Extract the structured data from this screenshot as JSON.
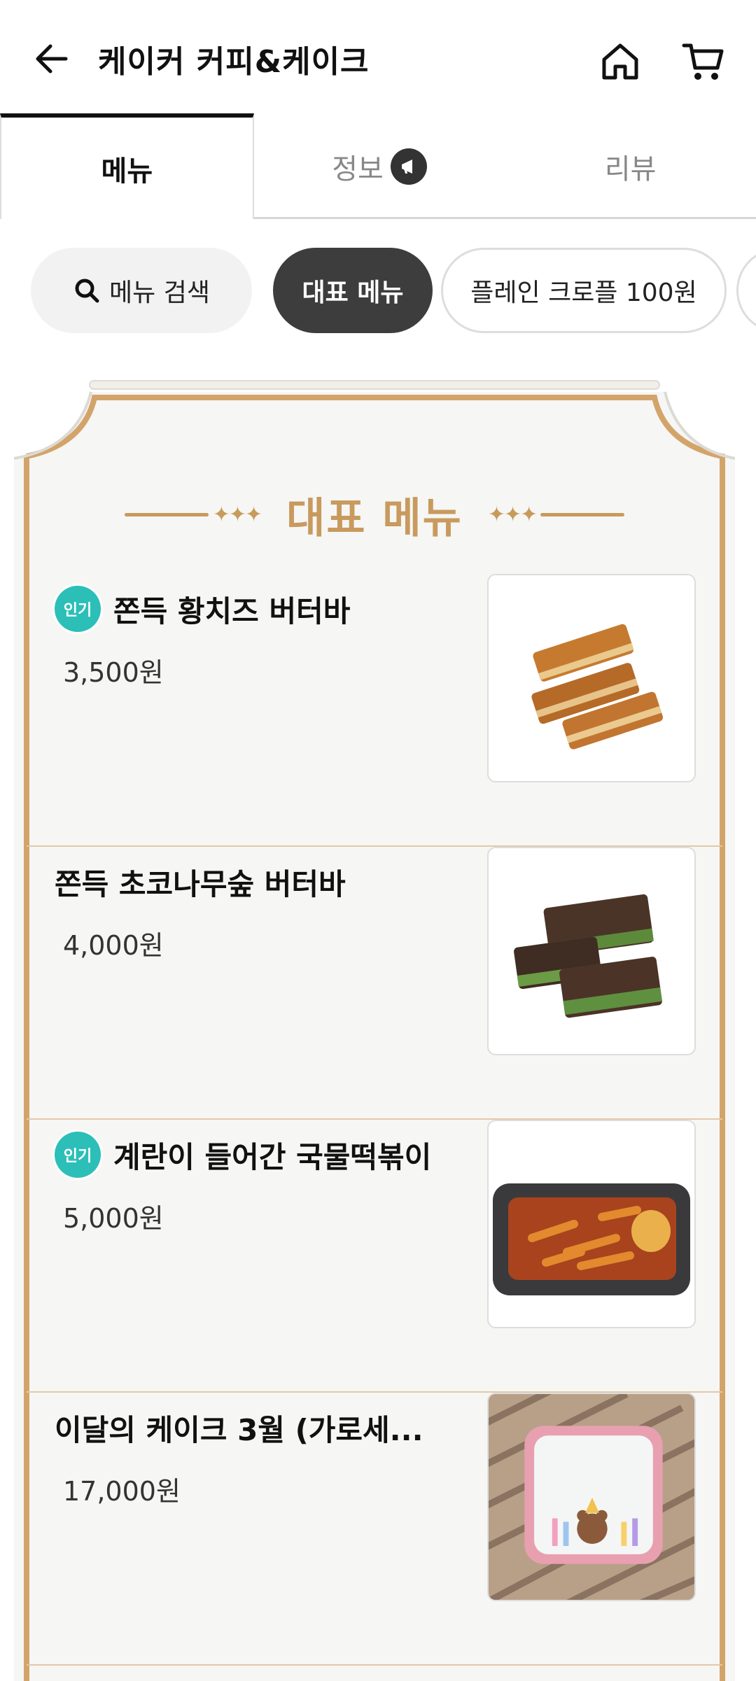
{
  "header": {
    "title": "케이커 커피&케이크",
    "back_icon": "arrow-left-icon",
    "home_icon": "home-icon",
    "cart_icon": "cart-icon"
  },
  "tabs": [
    {
      "label": "메뉴",
      "active": true
    },
    {
      "label": "정보",
      "active": false,
      "badge_icon": "megaphone-icon"
    },
    {
      "label": "리뷰",
      "active": false
    }
  ],
  "chips": {
    "search_label": "메뉴 검색",
    "items": [
      "대표 메뉴",
      "플레인 크로플 100원"
    ]
  },
  "section": {
    "title": "대표 메뉴"
  },
  "menu_items": [
    {
      "badge": "인기",
      "name": "쫀득 황치즈 버터바",
      "price": "3,500원"
    },
    {
      "badge": "",
      "name": "쫀득 초코나무숲 버터바",
      "price": "4,000원"
    },
    {
      "badge": "인기",
      "name": "계란이 들어간 국물떡볶이",
      "price": "5,000원"
    },
    {
      "badge": "",
      "name": "이달의 케이크 3월 (가로세...",
      "price": "17,000원"
    }
  ],
  "colors": {
    "accent_gold": "#c89a5e",
    "badge_teal": "#2bbfb8",
    "chip_active": "#3d3d3d"
  }
}
